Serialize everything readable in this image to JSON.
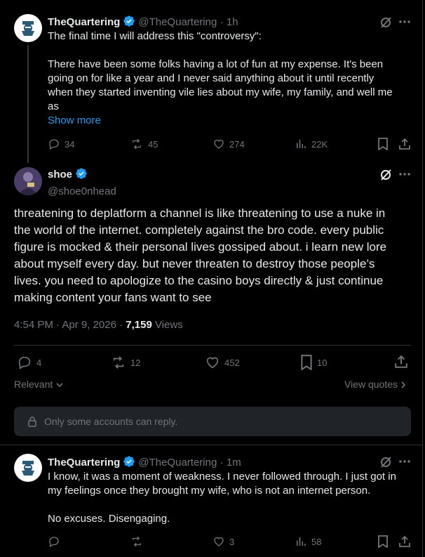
{
  "colors": {
    "accent": "#1d9bf0",
    "muted": "#71767b",
    "text": "#e7e9ea",
    "verified": "#1d9bf0"
  },
  "post1": {
    "name": "TheQuartering",
    "handle": "@TheQuartering",
    "time": "· 1h",
    "line1": "The final time I will address this \"controversy\":",
    "line2": "There have been some folks having a lot of fun at my expense.  It's been",
    "line3": "going on for like a year and I never said anything about it until recently",
    "line4": "when they started inventing vile lies about my wife, my family, and well me",
    "line5": "as",
    "show_more": "Show more",
    "replies": "34",
    "reposts": "45",
    "likes": "274",
    "views": "22K"
  },
  "main": {
    "name": "shoe",
    "handle": "@shoe0nhead",
    "l1": "threatening to deplatform a channel is like threatening to use a nuke in",
    "l2": "the world of the internet. completely against the bro code. every public",
    "l3": "figure is mocked & their personal lives gossiped about. i learn new lore",
    "l4": "about myself every day. but never threaten to destroy those people’s",
    "l5": "lives. you need to apologize to the casino boys directly & just continue",
    "l6": "making content your fans want to see",
    "timestamp": "4:54 PM · Apr 9, 2026 · ",
    "views_count": "7,159",
    "views_label": " Views",
    "replies": "4",
    "reposts": "12",
    "likes": "452",
    "bookmarks": "10",
    "sort_label": "Relevant",
    "view_quotes": "View quotes",
    "reply_restriction": "Only some accounts can reply."
  },
  "post3": {
    "name": "TheQuartering",
    "handle": "@TheQuartering",
    "time": "· 1m",
    "l1": "I know, it was a moment of weakness.  I never followed through.  I just got in",
    "l2": "my feelings once they brought my wife, who is not an internet person.",
    "l3": "No excuses.  Disengaging.",
    "likes": "3",
    "views": "58"
  }
}
